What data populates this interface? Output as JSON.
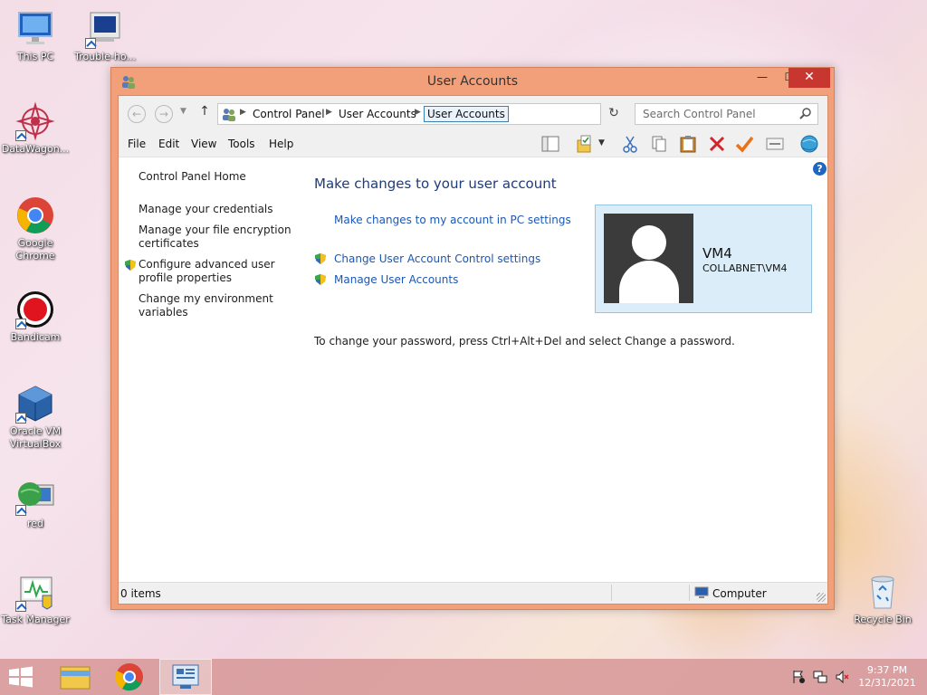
{
  "desktop": {
    "icons": [
      {
        "label": "This PC"
      },
      {
        "label": "Trouble-ho..."
      },
      {
        "label": "DataWagon..."
      },
      {
        "label": "Google Chrome"
      },
      {
        "label": "Bandicam"
      },
      {
        "label": "Oracle VM VirtualBox"
      },
      {
        "label": "red"
      },
      {
        "label": "Task Manager"
      },
      {
        "label": "Recycle Bin"
      }
    ]
  },
  "window": {
    "title": "User Accounts",
    "controls": {
      "minimize": "—",
      "maximize": "☐",
      "close": "✕"
    }
  },
  "address_bar": {
    "breadcrumbs": [
      "Control Panel",
      "User Accounts"
    ],
    "selected": "User Accounts",
    "search_placeholder": "Search Control Panel"
  },
  "menu": {
    "items": [
      "File",
      "Edit",
      "View",
      "Tools",
      "Help"
    ]
  },
  "left_pane": {
    "links": [
      "Control Panel Home",
      "Manage your credentials",
      "Manage your file encryption certificates",
      "Configure advanced user profile properties",
      "Change my environment variables"
    ]
  },
  "main": {
    "heading": "Make changes to your user account",
    "pc_settings_link": "Make changes to my account in PC settings",
    "uac_link": "Change User Account Control settings",
    "manage_link": "Manage User Accounts",
    "password_note": "To change your password, press Ctrl+Alt+Del and select Change a password."
  },
  "user": {
    "name": "VM4",
    "domain": "COLLABNET\\VM4"
  },
  "status_bar": {
    "items_count": "0 items",
    "location": "Computer"
  },
  "taskbar": {
    "time": "9:37 PM",
    "date": "12/31/2021"
  },
  "colors": {
    "window_frame": "#f2a07a",
    "close_button": "#c7372f",
    "link": "#1a57b5",
    "heading": "#1e3c78",
    "user_card_bg": "#dbedf8",
    "taskbar": "#d69696"
  }
}
